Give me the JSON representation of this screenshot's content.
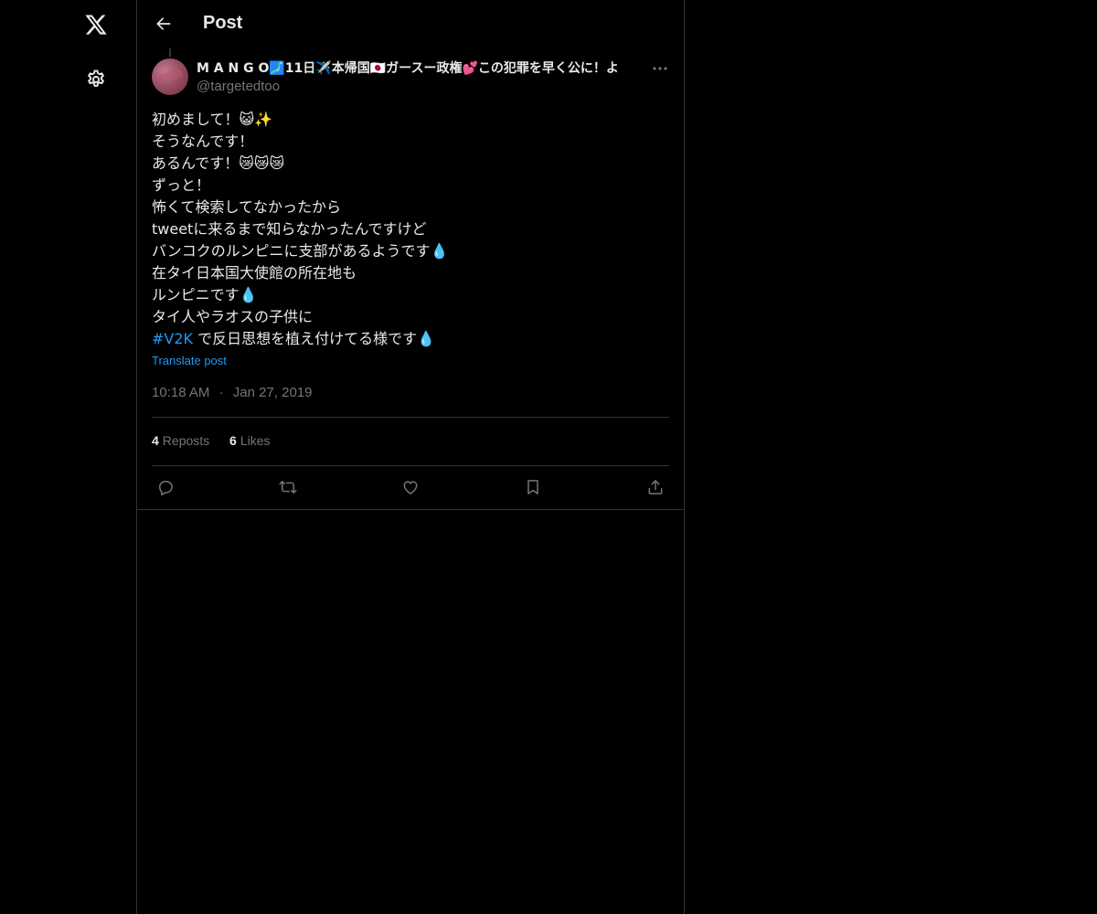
{
  "nav": {
    "logo_icon": "x-logo-icon",
    "settings_icon": "gear-icon"
  },
  "header": {
    "title": "Post",
    "back_icon": "arrow-left-icon"
  },
  "post": {
    "author_name": "M A N G O🗾11日✈️本帰国🇯🇵ガースー政権💕この犯罪を早く公に！よ",
    "author_handle": "@targetedtoo",
    "lines": [
      "初めまして！😺✨",
      "そうなんです！",
      "あるんです！😿😿😿",
      "ずっと！",
      "怖くて検索してなかったから",
      "tweetに来るまで知らなかったんですけど",
      "バンコクのルンピニに支部があるようです💧",
      "在タイ日本国大使館の所在地も",
      "ルンピニです💧",
      "タイ人やラオスの子供に"
    ],
    "last_line_hashtag": "#V2K",
    "last_line_rest": " で反日思想を植え付けてる様です💧",
    "translate_label": "Translate post",
    "time": "10:18 AM",
    "separator": "·",
    "date": "Jan 27, 2019",
    "reposts_count": "4",
    "reposts_label": "Reposts",
    "likes_count": "6",
    "likes_label": "Likes"
  },
  "actions": {
    "reply_icon": "reply-icon",
    "repost_icon": "repost-icon",
    "like_icon": "heart-icon",
    "bookmark_icon": "bookmark-icon",
    "share_icon": "share-icon"
  },
  "colors": {
    "background": "#000000",
    "text": "#e7e9ea",
    "muted": "#71767b",
    "accent": "#1d9bf0",
    "border": "#2f3336"
  }
}
